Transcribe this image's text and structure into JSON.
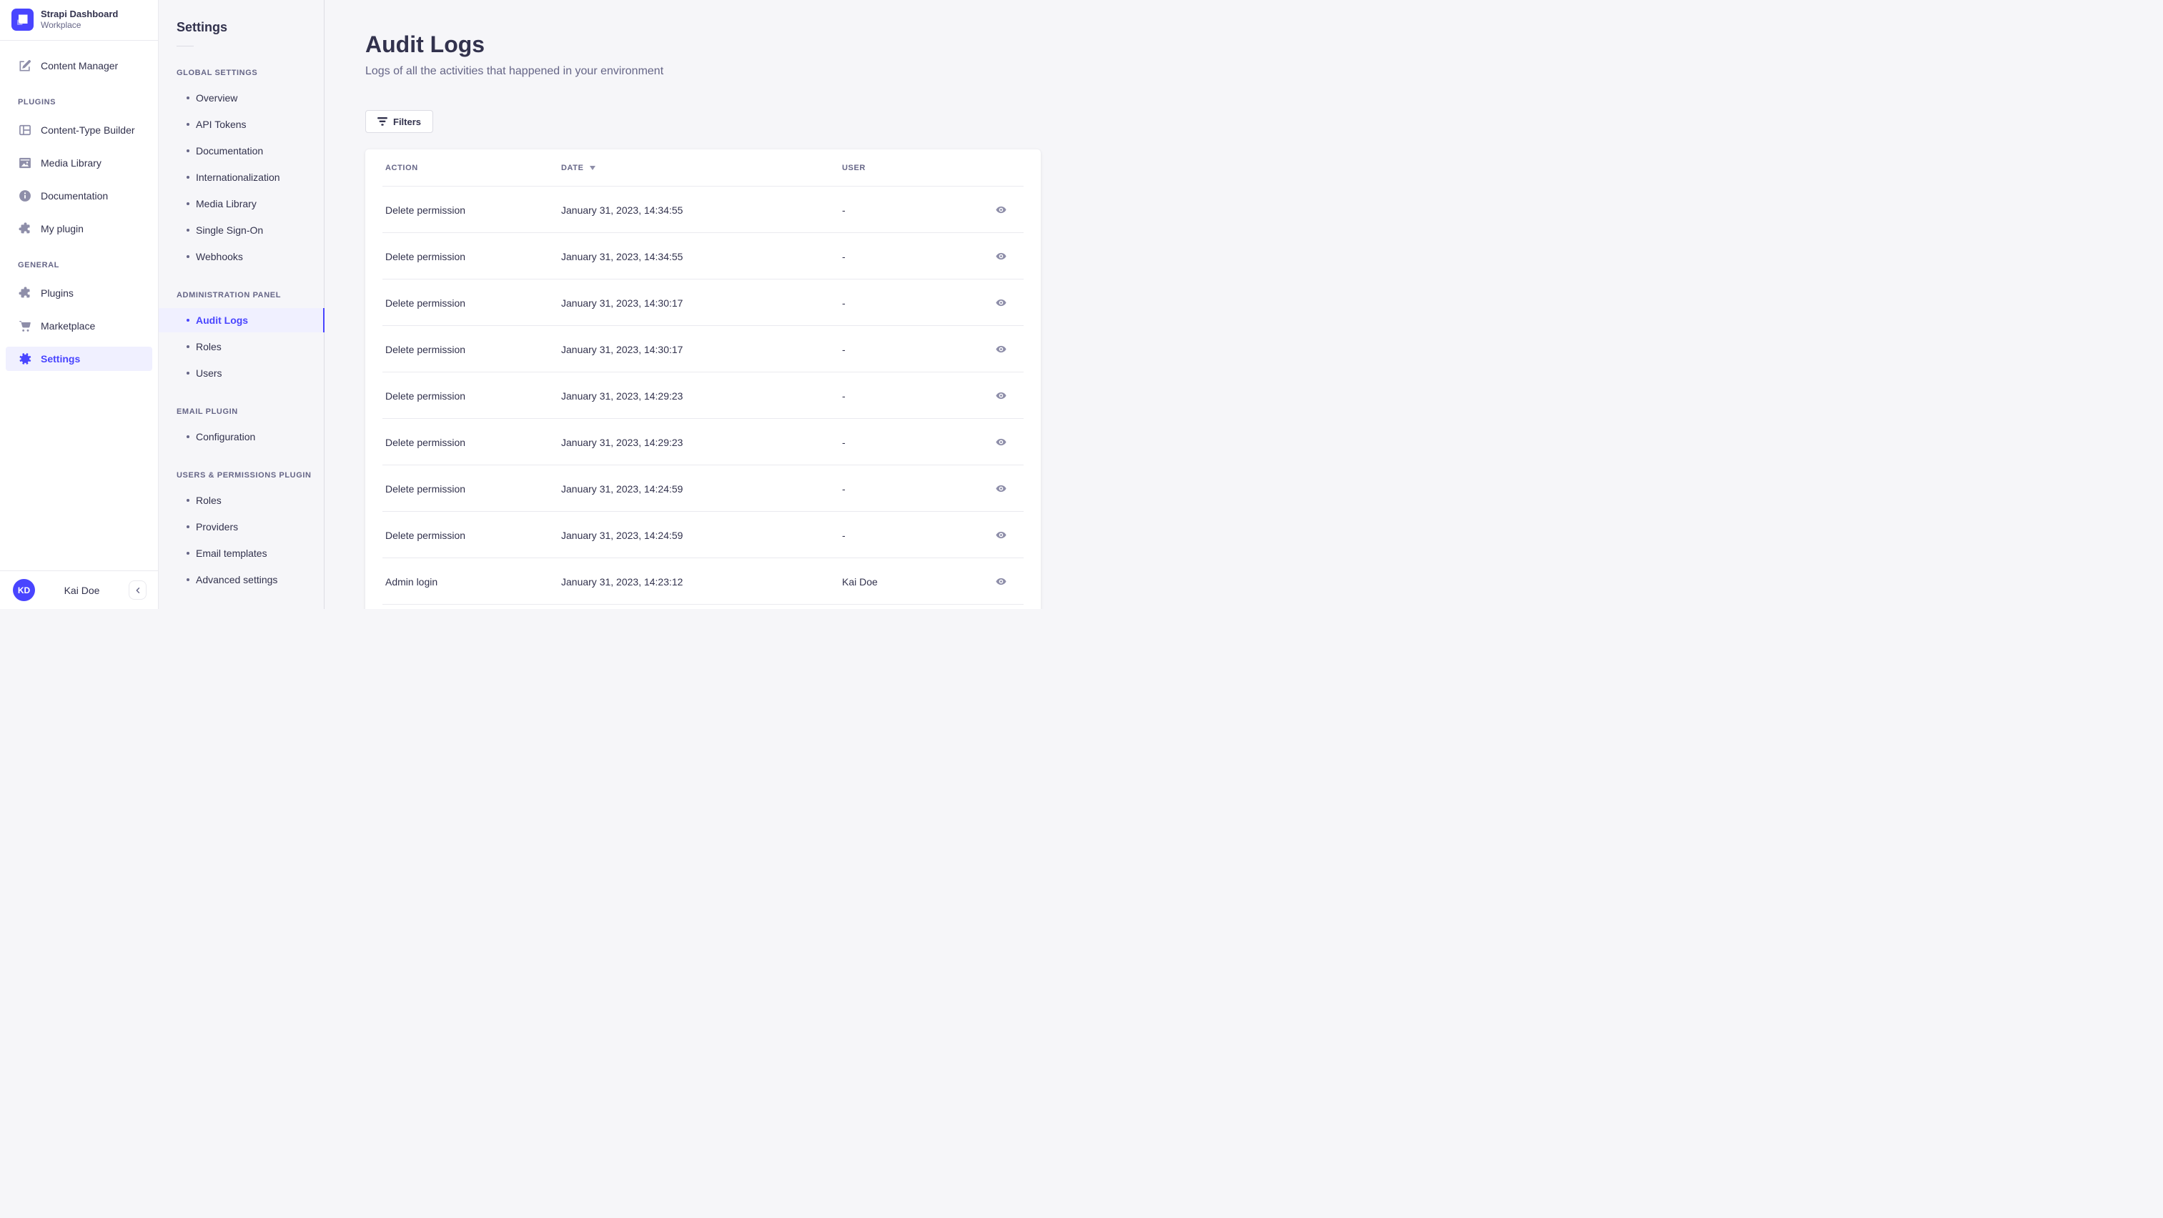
{
  "brand": {
    "title": "Strapi Dashboard",
    "subtitle": "Workplace"
  },
  "main_nav": {
    "content_manager": {
      "label": "Content Manager"
    },
    "sections": [
      {
        "label": "PLUGINS",
        "items": [
          {
            "label": "Content-Type Builder",
            "icon": "layout-icon"
          },
          {
            "label": "Media Library",
            "icon": "picture-icon"
          },
          {
            "label": "Documentation",
            "icon": "info-icon"
          },
          {
            "label": "My plugin",
            "icon": "puzzle-icon"
          }
        ]
      },
      {
        "label": "GENERAL",
        "items": [
          {
            "label": "Plugins",
            "icon": "puzzle-icon"
          },
          {
            "label": "Marketplace",
            "icon": "cart-icon"
          },
          {
            "label": "Settings",
            "icon": "gear-icon",
            "active": true
          }
        ]
      }
    ],
    "user": {
      "initials": "KD",
      "name": "Kai Doe"
    }
  },
  "subnav": {
    "heading": "Settings",
    "sections": [
      {
        "label": "GLOBAL SETTINGS",
        "items": [
          {
            "label": "Overview"
          },
          {
            "label": "API Tokens"
          },
          {
            "label": "Documentation"
          },
          {
            "label": "Internationalization"
          },
          {
            "label": "Media Library"
          },
          {
            "label": "Single Sign-On"
          },
          {
            "label": "Webhooks"
          }
        ]
      },
      {
        "label": "ADMINISTRATION PANEL",
        "items": [
          {
            "label": "Audit Logs",
            "active": true
          },
          {
            "label": "Roles"
          },
          {
            "label": "Users"
          }
        ]
      },
      {
        "label": "EMAIL PLUGIN",
        "items": [
          {
            "label": "Configuration"
          }
        ]
      },
      {
        "label": "USERS & PERMISSIONS PLUGIN",
        "items": [
          {
            "label": "Roles"
          },
          {
            "label": "Providers"
          },
          {
            "label": "Email templates"
          },
          {
            "label": "Advanced settings"
          }
        ]
      }
    ]
  },
  "page": {
    "title": "Audit Logs",
    "subtitle": "Logs of all the activities that happened in your environment",
    "filters_label": "Filters"
  },
  "table": {
    "headers": {
      "action": "ACTION",
      "date": "DATE",
      "user": "USER"
    },
    "sorted_by": "date",
    "sort_direction": "desc",
    "rows": [
      {
        "action": "Delete permission",
        "date": "January 31, 2023, 14:34:55",
        "user": "-"
      },
      {
        "action": "Delete permission",
        "date": "January 31, 2023, 14:34:55",
        "user": "-"
      },
      {
        "action": "Delete permission",
        "date": "January 31, 2023, 14:30:17",
        "user": "-"
      },
      {
        "action": "Delete permission",
        "date": "January 31, 2023, 14:30:17",
        "user": "-"
      },
      {
        "action": "Delete permission",
        "date": "January 31, 2023, 14:29:23",
        "user": "-"
      },
      {
        "action": "Delete permission",
        "date": "January 31, 2023, 14:29:23",
        "user": "-"
      },
      {
        "action": "Delete permission",
        "date": "January 31, 2023, 14:24:59",
        "user": "-"
      },
      {
        "action": "Delete permission",
        "date": "January 31, 2023, 14:24:59",
        "user": "-"
      },
      {
        "action": "Admin login",
        "date": "January 31, 2023, 14:23:12",
        "user": "Kai Doe"
      }
    ]
  },
  "help": {
    "label": "?"
  },
  "colors": {
    "primary": "#4945ff",
    "primary_bg": "#f0f0ff",
    "text": "#32324d",
    "muted": "#666687",
    "icon": "#8e8ea9",
    "border": "#eaeaef",
    "background": "#f6f6f9",
    "card": "#ffffff"
  }
}
